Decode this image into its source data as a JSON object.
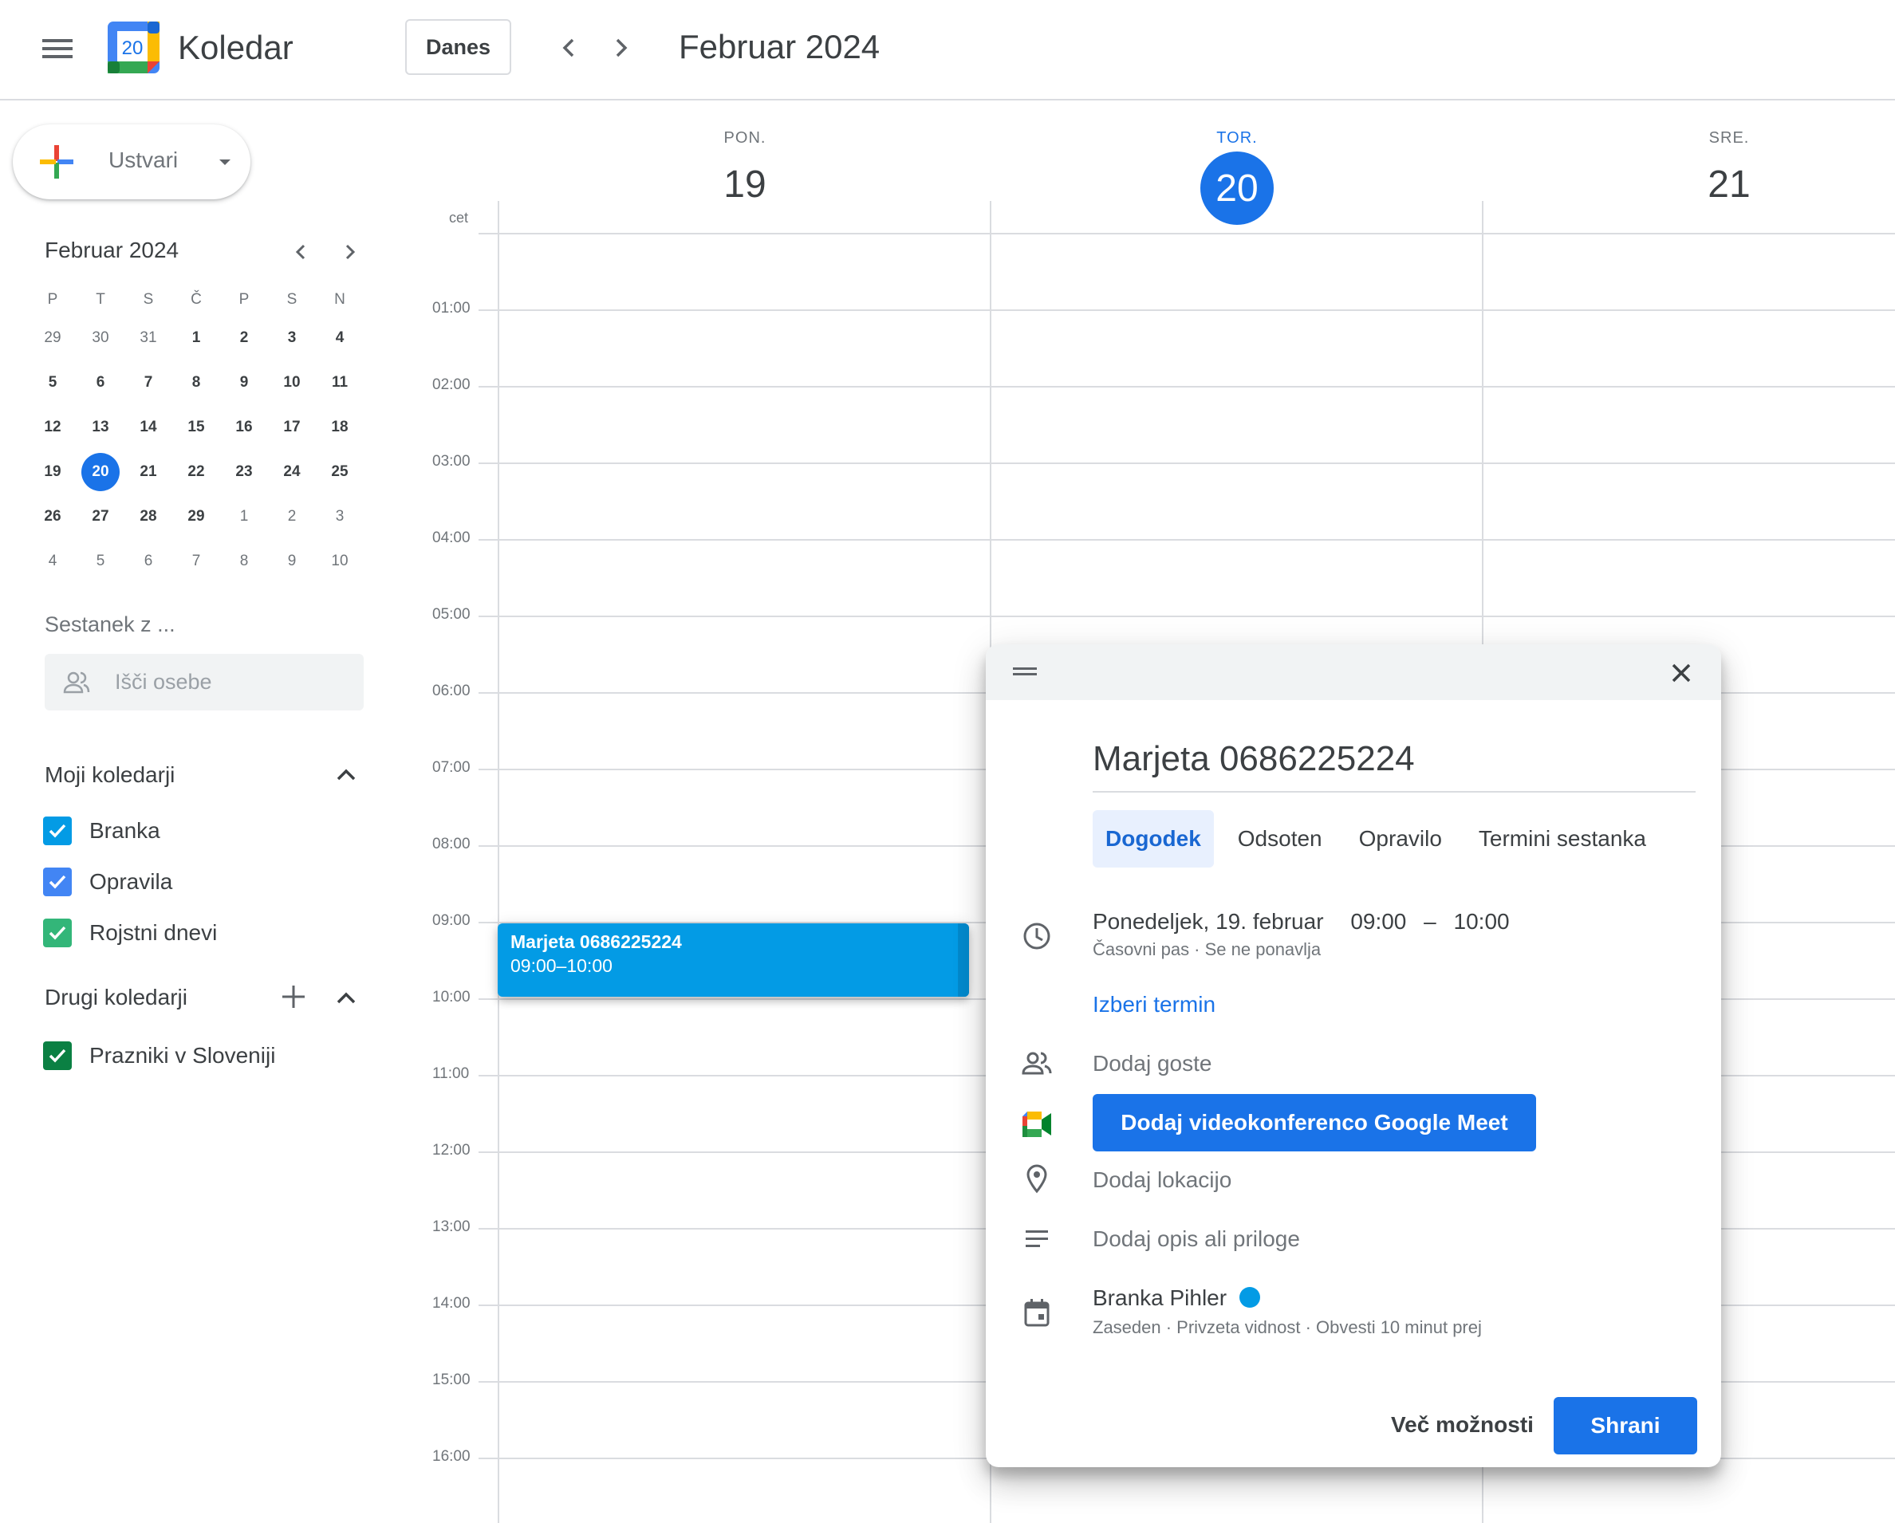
{
  "header": {
    "app_title": "Koledar",
    "logo_number": "20",
    "today_button": "Danes",
    "period_title": "Februar 2024"
  },
  "sidebar": {
    "create_label": "Ustvari",
    "mini_calendar": {
      "title": "Februar 2024",
      "weekdays": [
        "P",
        "T",
        "S",
        "Č",
        "P",
        "S",
        "N"
      ],
      "weeks": [
        [
          "29",
          "30",
          "31",
          "1",
          "2",
          "3",
          "4"
        ],
        [
          "5",
          "6",
          "7",
          "8",
          "9",
          "10",
          "11"
        ],
        [
          "12",
          "13",
          "14",
          "15",
          "16",
          "17",
          "18"
        ],
        [
          "19",
          "20",
          "21",
          "22",
          "23",
          "24",
          "25"
        ],
        [
          "26",
          "27",
          "28",
          "29",
          "1",
          "2",
          "3"
        ],
        [
          "4",
          "5",
          "6",
          "7",
          "8",
          "9",
          "10"
        ]
      ],
      "today": "20"
    },
    "meeting_with_label": "Sestanek z ...",
    "search_people_placeholder": "Išči osebe",
    "my_calendars_title": "Moji koledarji",
    "my_calendars": [
      {
        "name": "Branka",
        "color": "#039be5"
      },
      {
        "name": "Opravila",
        "color": "#4285f4"
      },
      {
        "name": "Rojstni dnevi",
        "color": "#33b679"
      }
    ],
    "other_calendars_title": "Drugi koledarji",
    "other_calendars": [
      {
        "name": "Prazniki v Sloveniji",
        "color": "#0b8043"
      }
    ]
  },
  "week_view": {
    "timezone_label": "cet",
    "days": [
      {
        "dow": "PON.",
        "num": "19"
      },
      {
        "dow": "TOR.",
        "num": "20"
      },
      {
        "dow": "SRE.",
        "num": "21"
      }
    ],
    "hours": [
      "01:00",
      "02:00",
      "03:00",
      "04:00",
      "05:00",
      "06:00",
      "07:00",
      "08:00",
      "09:00",
      "10:00",
      "11:00",
      "12:00",
      "13:00",
      "14:00",
      "15:00",
      "16:00"
    ]
  },
  "event": {
    "title": "Marjeta 0686225224",
    "time": "09:00–10:00",
    "color": "#039be5"
  },
  "dialog": {
    "title": "Marjeta 0686225224",
    "tabs": [
      "Dogodek",
      "Odsoten",
      "Opravilo",
      "Termini sestanka"
    ],
    "date_text": "Ponedeljek, 19. februar",
    "start_time": "09:00",
    "dash": "–",
    "end_time": "10:00",
    "time_sub": "Časovni pas · Se ne ponavlja",
    "find_time": "Izberi termin",
    "add_guests": "Dodaj goste",
    "meet_button": "Dodaj videokonferenco Google Meet",
    "add_location": "Dodaj lokacijo",
    "add_description": "Dodaj opis ali priloge",
    "calendar_owner": "Branka Pihler",
    "calendar_sub": "Zaseden · Privzeta vidnost · Obvesti 10 minut prej",
    "more_options": "Več možnosti",
    "save": "Shrani"
  },
  "colors": {
    "accent": "#1a73e8",
    "event": "#039be5"
  }
}
